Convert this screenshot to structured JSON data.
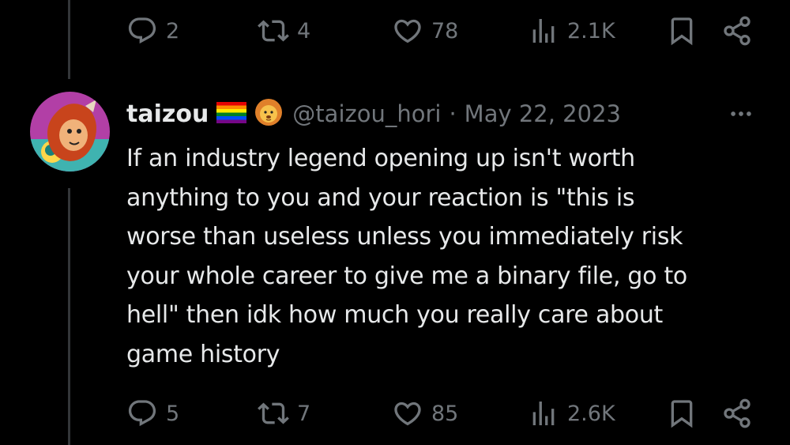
{
  "prev_actions": {
    "reply": "2",
    "retweet": "4",
    "like": "78",
    "views": "2.1K"
  },
  "tweet": {
    "display_name": "taizou",
    "badges": [
      "rainbow-flag-icon",
      "lion-face-icon"
    ],
    "handle": "@taizou_hori",
    "separator": "·",
    "date": "May 22, 2023",
    "text_lines": [
      "If an industry legend opening up isn't worth",
      "anything to you and your reaction is \"this is",
      "worse than useless unless you immediately risk",
      "your whole career to give me a binary file, go to",
      "hell\" then idk how much you really care about",
      "game history"
    ],
    "actions": {
      "reply": "5",
      "retweet": "7",
      "like": "85",
      "views": "2.6K"
    }
  },
  "colors": {
    "background": "#000000",
    "text": "#e7e9ea",
    "muted": "#71767b",
    "thread_line": "#333639"
  }
}
